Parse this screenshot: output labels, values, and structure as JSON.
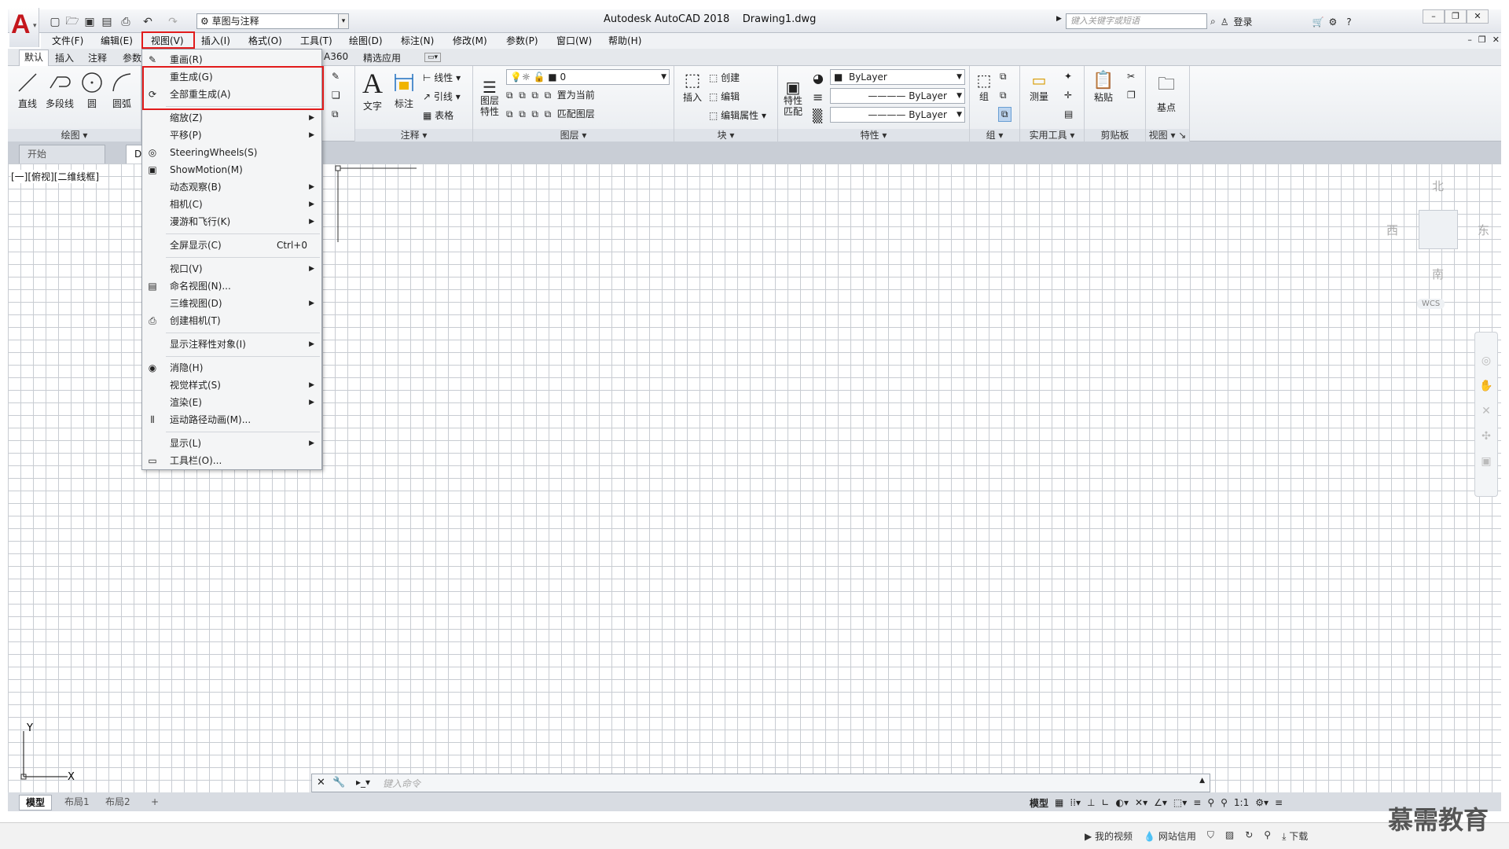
{
  "app": {
    "title": "Autodesk AutoCAD 2018",
    "document": "Drawing1.dwg",
    "logo_letter": "A",
    "workspace": "草图与注释",
    "search_placeholder": "键入关键字或短语",
    "login": "登录"
  },
  "menubar": [
    "文件(F)",
    "编辑(E)",
    "视图(V)",
    "插入(I)",
    "格式(O)",
    "工具(T)",
    "绘图(D)",
    "标注(N)",
    "修改(M)",
    "参数(P)",
    "窗口(W)",
    "帮助(H)"
  ],
  "ribbon_tabs": [
    "默认",
    "插入",
    "注释",
    "参数",
    "A360",
    "精选应用"
  ],
  "ribbon": {
    "draw_tools": [
      "直线",
      "多段线",
      "圆",
      "圆弧"
    ],
    "draw_title": "绘图",
    "annotate_title": "注释",
    "text_label": "文字",
    "dim_label": "标注",
    "linear": "线性",
    "leader": "引线",
    "table": "表格",
    "layers_title": "图层",
    "layer_props": "图层\n特性",
    "layer_value": "0",
    "set_current": "置为当前",
    "match_layer": "匹配图层",
    "block_title": "块",
    "insert": "插入",
    "create": "创建",
    "edit": "编辑",
    "edit_attr": "编辑属性",
    "props_title": "特性",
    "match_props": "特性\n匹配",
    "bylayer": "ByLayer",
    "groups_title": "组",
    "group": "组",
    "utilities_title": "实用工具",
    "measure": "测量",
    "clipboard_title": "剪贴板",
    "paste": "粘贴",
    "view_title": "视图",
    "base": "基点"
  },
  "doc_tabs": [
    "开始",
    "Dr"
  ],
  "viewport_label": "[一][俯视][二维线框]",
  "viewcube": {
    "north": "北",
    "south": "南",
    "east": "东",
    "west": "西",
    "wcs": "WCS"
  },
  "command_placeholder": "键入命令",
  "layout_tabs": [
    "模型",
    "布局1",
    "布局2"
  ],
  "status": {
    "model": "模型",
    "scale": "1:1"
  },
  "taskbar": [
    "我的视频",
    "网站信用",
    "下载"
  ],
  "watermark": "慕需教育",
  "view_menu": {
    "items": [
      {
        "label": "重画(R)",
        "icon": "pencil-icon",
        "arrow": false
      },
      {
        "label": "重生成(G)",
        "icon": "",
        "arrow": false
      },
      {
        "label": "全部重生成(A)",
        "icon": "regen-all-icon",
        "arrow": false
      },
      {
        "sep": true
      },
      {
        "label": "缩放(Z)",
        "icon": "",
        "arrow": true
      },
      {
        "label": "平移(P)",
        "icon": "",
        "arrow": true
      },
      {
        "label": "SteeringWheels(S)",
        "icon": "wheel-icon",
        "arrow": false
      },
      {
        "label": "ShowMotion(M)",
        "icon": "showmotion-icon",
        "arrow": false
      },
      {
        "label": "动态观察(B)",
        "icon": "",
        "arrow": true
      },
      {
        "label": "相机(C)",
        "icon": "",
        "arrow": true
      },
      {
        "label": "漫游和飞行(K)",
        "icon": "",
        "arrow": true
      },
      {
        "sep": true
      },
      {
        "label": "全屏显示(C)",
        "icon": "",
        "arrow": false,
        "shortcut": "Ctrl+0"
      },
      {
        "sep": true
      },
      {
        "label": "视口(V)",
        "icon": "",
        "arrow": true
      },
      {
        "label": "命名视图(N)...",
        "icon": "named-view-icon",
        "arrow": false
      },
      {
        "label": "三维视图(D)",
        "icon": "",
        "arrow": true
      },
      {
        "label": "创建相机(T)",
        "icon": "camera-icon",
        "arrow": false
      },
      {
        "sep": true
      },
      {
        "label": "显示注释性对象(I)",
        "icon": "",
        "arrow": true
      },
      {
        "sep": true
      },
      {
        "label": "消隐(H)",
        "icon": "hide-icon",
        "arrow": false
      },
      {
        "label": "视觉样式(S)",
        "icon": "",
        "arrow": true
      },
      {
        "label": "渲染(E)",
        "icon": "",
        "arrow": true
      },
      {
        "label": "运动路径动画(M)...",
        "icon": "motion-path-icon",
        "arrow": false
      },
      {
        "sep": true
      },
      {
        "label": "显示(L)",
        "icon": "",
        "arrow": true
      },
      {
        "label": "工具栏(O)...",
        "icon": "toolbar-icon",
        "arrow": false
      }
    ]
  }
}
